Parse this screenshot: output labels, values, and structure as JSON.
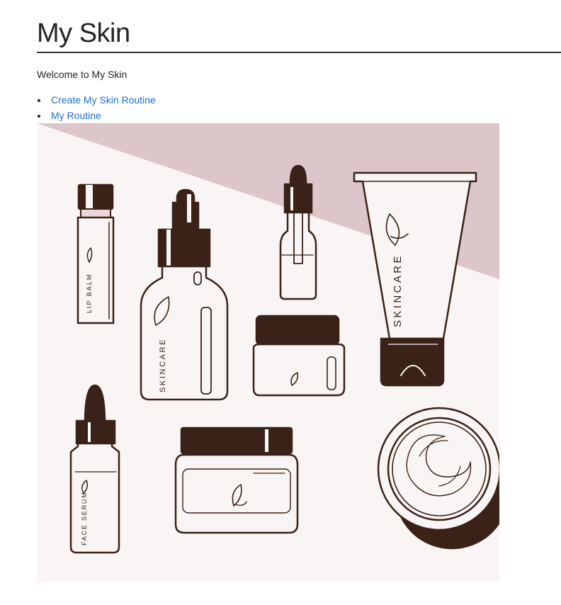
{
  "header": {
    "title": "My Skin"
  },
  "intro": {
    "welcome_text": "Welcome to My Skin"
  },
  "nav": {
    "links": [
      {
        "label": "Create My Skin Routine"
      },
      {
        "label": "My Routine"
      }
    ]
  },
  "hero": {
    "labels": {
      "lip_balm": "LIP BALM",
      "skincare_bottle": "SKINCARE",
      "skincare_tube": "SKINCARE",
      "face_serum": "FACE SERUM"
    }
  },
  "colors": {
    "text": "#212529",
    "link": "#1a6fd0",
    "rule": "#333333",
    "illustration_background": "#f8f5f4",
    "illustration_accent": "#dcc6ca",
    "illustration_ink": "#3a2218"
  }
}
